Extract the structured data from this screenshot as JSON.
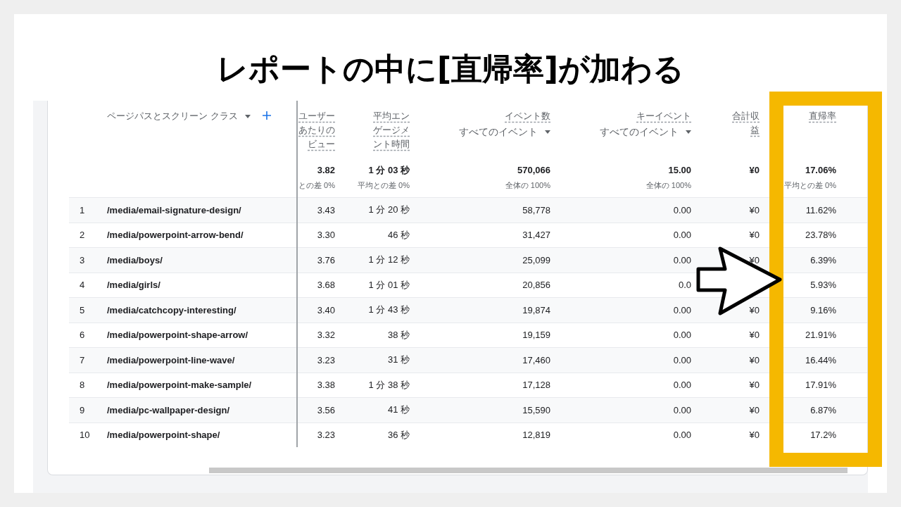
{
  "slide_title": "レポートの中に[直帰率]が加わる",
  "table": {
    "dimension_header": "ページパスとスクリーン クラス",
    "columns": [
      {
        "title": "ユーザーあたりのビュー",
        "total": "3.82",
        "total_note": "との差 0%"
      },
      {
        "title": "平均エンゲージメント時間",
        "total": "1 分 03 秒",
        "total_note": "平均との差 0%"
      },
      {
        "title": "イベント数",
        "selector": "すべてのイベント",
        "total": "570,066",
        "total_note": "全体の 100%"
      },
      {
        "title": "キーイベント",
        "selector": "すべてのイベント",
        "total": "15.00",
        "total_note": "全体の 100%"
      },
      {
        "title": "合計収益",
        "total": "¥0"
      },
      {
        "title": "直帰率",
        "total": "17.06%",
        "total_note": "平均との差 0%"
      }
    ],
    "rows": [
      {
        "index": "1",
        "path": "/media/email-signature-design/",
        "cells": [
          "3.43",
          "1 分 20 秒",
          "58,778",
          "0.00",
          "¥0",
          "11.62%"
        ]
      },
      {
        "index": "2",
        "path": "/media/powerpoint-arrow-bend/",
        "cells": [
          "3.30",
          "46 秒",
          "31,427",
          "0.00",
          "¥0",
          "23.78%"
        ]
      },
      {
        "index": "3",
        "path": "/media/boys/",
        "cells": [
          "3.76",
          "1 分 12 秒",
          "25,099",
          "0.00",
          "¥0",
          "6.39%"
        ]
      },
      {
        "index": "4",
        "path": "/media/girls/",
        "cells": [
          "3.68",
          "1 分 01 秒",
          "20,856",
          "0.0",
          null,
          "5.93%"
        ]
      },
      {
        "index": "5",
        "path": "/media/catchcopy-interesting/",
        "cells": [
          "3.40",
          "1 分 43 秒",
          "19,874",
          "0.00",
          "¥0",
          "9.16%"
        ]
      },
      {
        "index": "6",
        "path": "/media/powerpoint-shape-arrow/",
        "cells": [
          "3.32",
          "38 秒",
          "19,159",
          "0.00",
          "¥0",
          "21.91%"
        ]
      },
      {
        "index": "7",
        "path": "/media/powerpoint-line-wave/",
        "cells": [
          "3.23",
          "31 秒",
          "17,460",
          "0.00",
          "¥0",
          "16.44%"
        ]
      },
      {
        "index": "8",
        "path": "/media/powerpoint-make-sample/",
        "cells": [
          "3.38",
          "1 分 38 秒",
          "17,128",
          "0.00",
          "¥0",
          "17.91%"
        ]
      },
      {
        "index": "9",
        "path": "/media/pc-wallpaper-design/",
        "cells": [
          "3.56",
          "41 秒",
          "15,590",
          "0.00",
          "¥0",
          "6.87%"
        ]
      },
      {
        "index": "10",
        "path": "/media/powerpoint-shape/",
        "cells": [
          "3.23",
          "36 秒",
          "12,819",
          "0.00",
          "¥0",
          "17.2%"
        ]
      }
    ]
  }
}
